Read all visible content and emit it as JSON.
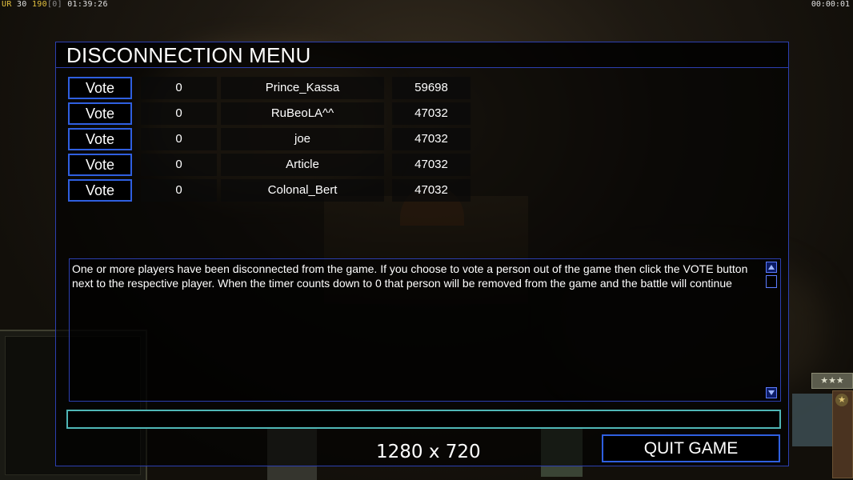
{
  "hud": {
    "top_left_prefix": "UR",
    "top_left_a": "30",
    "top_left_b": "190",
    "top_left_c": "[0]",
    "game_clock": "01:39:26",
    "timer": "00:00:01"
  },
  "dialog": {
    "title": "DISCONNECTION MENU",
    "players": [
      {
        "vote_label": "Vote",
        "timer": "0",
        "name": "Prince_Kassa",
        "ping": "59698"
      },
      {
        "vote_label": "Vote",
        "timer": "0",
        "name": "RuBeoLA^^",
        "ping": "47032"
      },
      {
        "vote_label": "Vote",
        "timer": "0",
        "name": "joe",
        "ping": "47032"
      },
      {
        "vote_label": "Vote",
        "timer": "0",
        "name": "Article",
        "ping": "47032"
      },
      {
        "vote_label": "Vote",
        "timer": "0",
        "name": "Colonal_Bert",
        "ping": "47032"
      }
    ],
    "message": "One or more players have been disconnected from the game. If you choose to vote a person out of the game then click the VOTE button next to the respective player. When the timer counts down to 0 that person will be removed from the game and the battle will continue",
    "chat_value": "",
    "resolution": "1280 x 720",
    "quit_label": "QUIT GAME"
  },
  "hud_bottom": {
    "rank_stars": "★★★",
    "general_star": "★"
  }
}
